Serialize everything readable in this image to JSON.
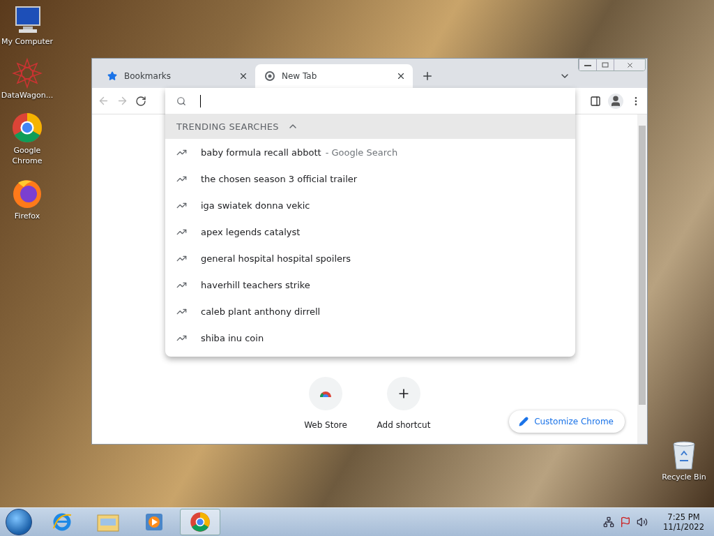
{
  "desktop_icons": [
    {
      "label": "My Computer",
      "kind": "computer"
    },
    {
      "label": "DataWagon...",
      "kind": "star"
    },
    {
      "label": "Google Chrome",
      "kind": "chrome"
    },
    {
      "label": "Firefox",
      "kind": "firefox"
    }
  ],
  "recycle_bin": {
    "label": "Recycle Bin"
  },
  "browser": {
    "tabs": [
      {
        "title": "Bookmarks",
        "kind": "bookmark",
        "selected": false
      },
      {
        "title": "New Tab",
        "kind": "chrome",
        "selected": true
      }
    ],
    "suggestions": {
      "header": "TRENDING SEARCHES",
      "expanded": true,
      "items": [
        {
          "text": "baby formula recall abbott",
          "suffix": "- Google Search"
        },
        {
          "text": "the chosen season 3 official trailer"
        },
        {
          "text": "iga swiatek donna vekic"
        },
        {
          "text": "apex legends catalyst"
        },
        {
          "text": "general hospital hospital spoilers"
        },
        {
          "text": "haverhill teachers strike"
        },
        {
          "text": "caleb plant anthony dirrell"
        },
        {
          "text": "shiba inu coin"
        }
      ]
    },
    "shortcuts": [
      {
        "label": "Web Store",
        "kind": "store"
      },
      {
        "label": "Add shortcut",
        "kind": "add"
      }
    ],
    "customize_button": "Customize Chrome"
  },
  "taskbar": {
    "apps": [
      {
        "kind": "ie",
        "selected": false
      },
      {
        "kind": "explorer",
        "selected": false
      },
      {
        "kind": "media",
        "selected": false
      },
      {
        "kind": "chrome",
        "selected": true
      }
    ],
    "clock": {
      "time": "7:25 PM",
      "date": "11/1/2022"
    }
  }
}
